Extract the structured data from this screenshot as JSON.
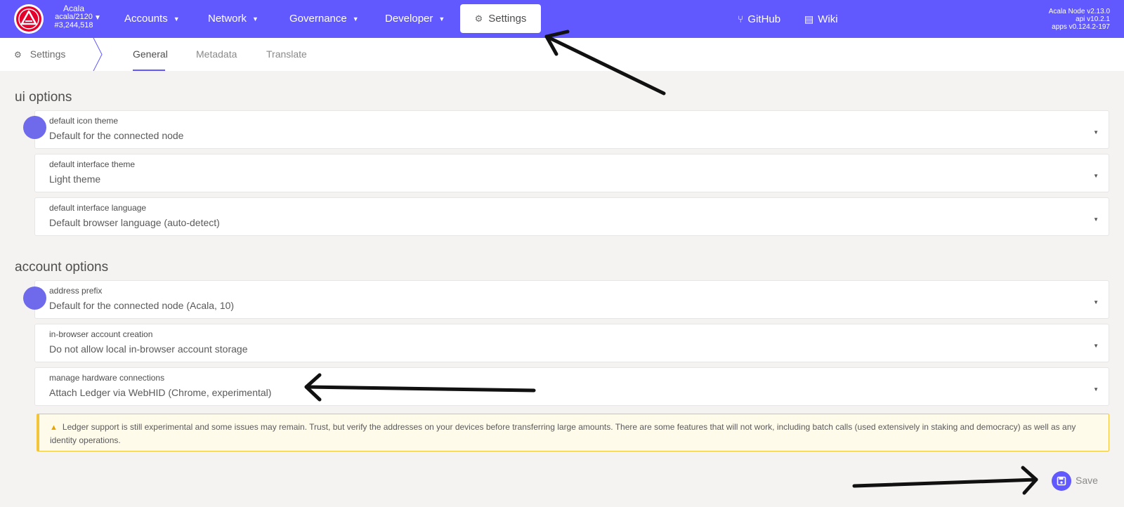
{
  "topbar": {
    "chain": {
      "name": "Acala",
      "spec": "acala/2120",
      "block": "#3,244,518"
    },
    "nav": [
      {
        "label": "Accounts"
      },
      {
        "label": "Network"
      },
      {
        "label": "Governance"
      },
      {
        "label": "Developer"
      }
    ],
    "active_nav": {
      "label": "Settings",
      "icon": "gears-icon"
    },
    "links": [
      {
        "label": "GitHub",
        "icon": "code-branch-icon"
      },
      {
        "label": "Wiki",
        "icon": "book-icon"
      }
    ],
    "version": {
      "node": "Acala Node v2.13.0",
      "api": "api v10.2.1",
      "apps": "apps v0.124.2-197"
    },
    "accent_color": "#6159fd"
  },
  "subnav": {
    "title": "Settings",
    "tabs": [
      {
        "label": "General",
        "active": true
      },
      {
        "label": "Metadata",
        "active": false
      },
      {
        "label": "Translate",
        "active": false
      }
    ]
  },
  "ui_options": {
    "title": "ui options",
    "fields": [
      {
        "label": "default icon theme",
        "value": "Default for the connected node"
      },
      {
        "label": "default interface theme",
        "value": "Light theme"
      },
      {
        "label": "default interface language",
        "value": "Default browser language (auto-detect)"
      }
    ]
  },
  "account_options": {
    "title": "account options",
    "fields": [
      {
        "label": "address prefix",
        "value": "Default for the connected node (Acala, 10)"
      },
      {
        "label": "in-browser account creation",
        "value": "Do not allow local in-browser account storage"
      },
      {
        "label": "manage hardware connections",
        "value": "Attach Ledger via WebHID (Chrome, experimental)"
      }
    ]
  },
  "warning": {
    "icon": "warning-triangle-icon",
    "text": "Ledger support is still experimental and some issues may remain. Trust, but verify the addresses on your devices before transferring large amounts. There are some features that will not work, including batch calls (used extensively in staking and democracy) as well as any identity operations."
  },
  "save": {
    "label": "Save",
    "icon": "save-icon"
  }
}
